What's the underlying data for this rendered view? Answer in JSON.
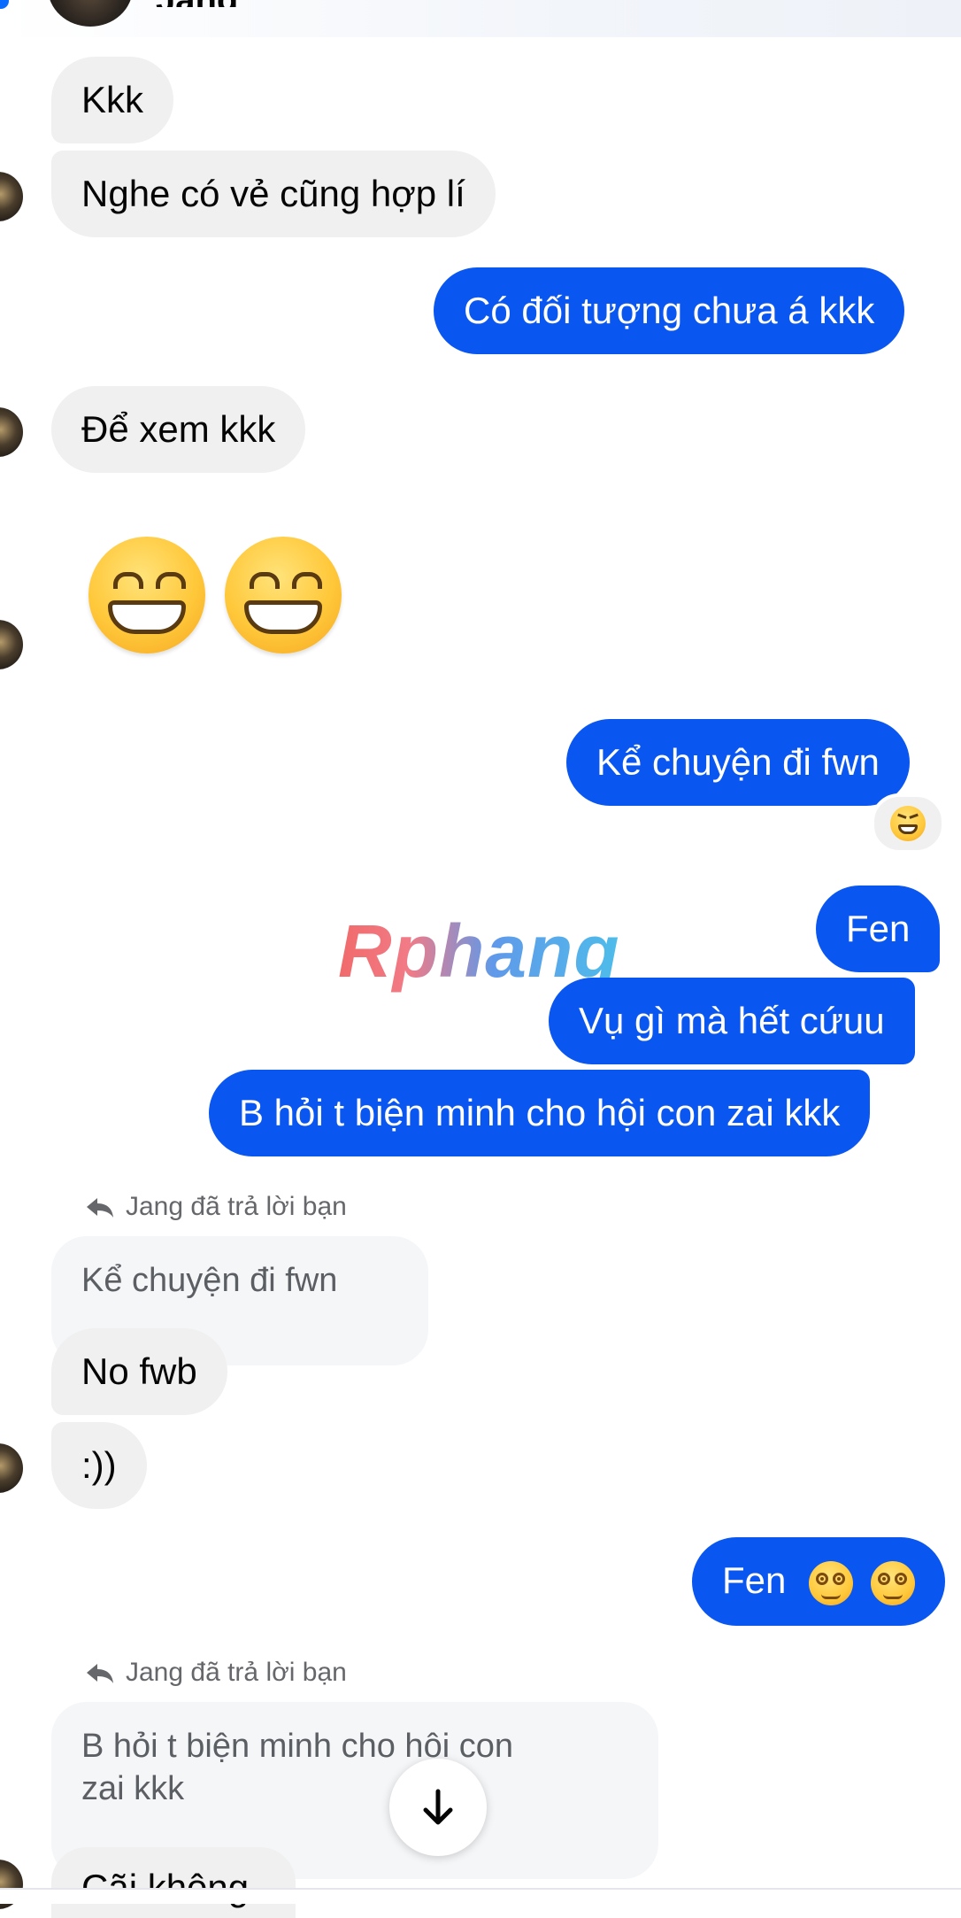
{
  "header": {
    "contact_name": "Jang"
  },
  "messages": [
    {
      "id": "m1",
      "direction": "in",
      "text": "Kkk"
    },
    {
      "id": "m2",
      "direction": "in",
      "text": "Nghe có vẻ cũng hợp lí"
    },
    {
      "id": "m3",
      "direction": "out",
      "text": "Có đối tượng chưa á kkk"
    },
    {
      "id": "m4",
      "direction": "in",
      "text": "Để xem kkk"
    },
    {
      "id": "m5",
      "direction": "in",
      "emoji": [
        "grinning-face-with-smiling-eyes",
        "grinning-face-with-smiling-eyes"
      ]
    },
    {
      "id": "m6",
      "direction": "out",
      "text": "Kể chuyện đi fwn",
      "reaction": "laughing-face"
    },
    {
      "id": "m7",
      "direction": "out",
      "text": "Fen"
    },
    {
      "id": "m8",
      "direction": "out",
      "text": "Vụ gì mà hết cứuu"
    },
    {
      "id": "m9",
      "direction": "out",
      "text": "B hỏi t biện minh cho hội con zai kkk"
    },
    {
      "id": "m10",
      "direction": "in",
      "reply_label": "Jang đã trả lời bạn",
      "quoted": "Kể chuyện đi fwn",
      "text": "No fwb"
    },
    {
      "id": "m11",
      "direction": "in",
      "text": ":))"
    },
    {
      "id": "m12",
      "direction": "out",
      "text": "Fen",
      "emoji": [
        "face-with-spiral-eyes",
        "face-with-spiral-eyes"
      ]
    },
    {
      "id": "m13",
      "direction": "in",
      "reply_label": "Jang đã trả lời bạn",
      "quoted_line1": "B hỏi t biện minh cho hội con",
      "quoted_line2": "zai kkk",
      "text": "Cãi không"
    }
  ],
  "watermark": "Rphang",
  "colors": {
    "outgoing": "#0a56f0",
    "incoming": "#f0f0f0",
    "quote": "#f5f6f8"
  }
}
